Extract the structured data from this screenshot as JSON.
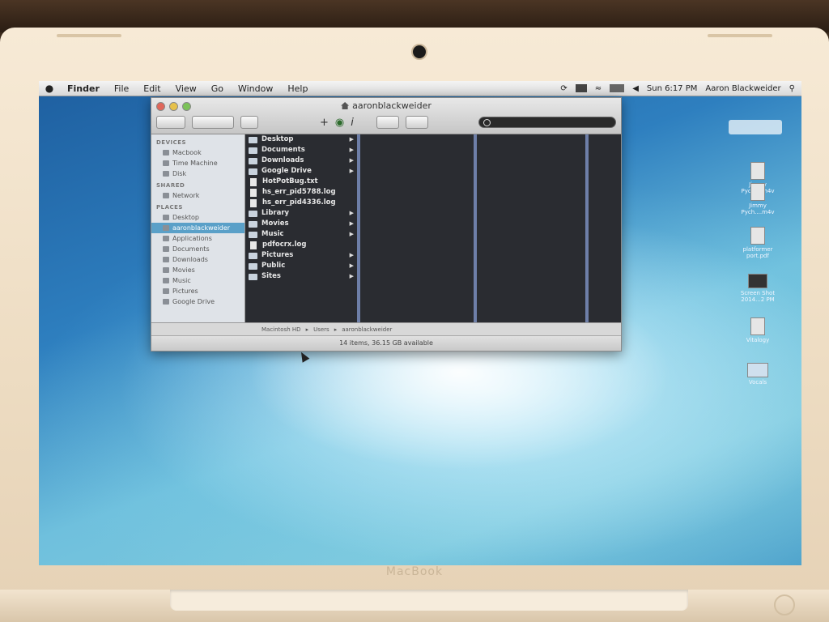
{
  "laptop": {
    "brand": "MacBook"
  },
  "menubar": {
    "items": [
      "Finder",
      "File",
      "Edit",
      "View",
      "Go",
      "Window",
      "Help"
    ],
    "clock": "Sun 6:17 PM",
    "user": "Aaron Blackweider"
  },
  "finder": {
    "title": "aaronblackweider",
    "search_placeholder": "",
    "sidebar": {
      "devices_header": "DEVICES",
      "devices": [
        "Macbook",
        "Time Machine",
        "Disk"
      ],
      "shared_header": "SHARED",
      "shared": [
        "Network"
      ],
      "places_header": "PLACES",
      "places": [
        "Desktop",
        "aaronblackweider",
        "Applications",
        "Documents",
        "Downloads",
        "Movies",
        "Music",
        "Pictures",
        "Google Drive"
      ]
    },
    "files": [
      {
        "name": "Desktop",
        "kind": "folder"
      },
      {
        "name": "Documents",
        "kind": "folder"
      },
      {
        "name": "Downloads",
        "kind": "folder"
      },
      {
        "name": "Google Drive",
        "kind": "folder"
      },
      {
        "name": "HotPotBug.txt",
        "kind": "file"
      },
      {
        "name": "hs_err_pid5788.log",
        "kind": "file"
      },
      {
        "name": "hs_err_pid4336.log",
        "kind": "file"
      },
      {
        "name": "Library",
        "kind": "folder"
      },
      {
        "name": "Movies",
        "kind": "folder"
      },
      {
        "name": "Music",
        "kind": "folder"
      },
      {
        "name": "pdfocrx.log",
        "kind": "file"
      },
      {
        "name": "Pictures",
        "kind": "folder"
      },
      {
        "name": "Public",
        "kind": "folder"
      },
      {
        "name": "Sites",
        "kind": "folder"
      }
    ],
    "path": [
      "Macintosh HD",
      "Users",
      "aaronblackweider"
    ],
    "status": "14 items, 36.15 GB available"
  },
  "desktop_icons": [
    {
      "label": "Jimmy Pych....m4v",
      "type": "file"
    },
    {
      "label": "Jimmy Pych....m4v",
      "type": "file"
    },
    {
      "label": "platformer port.pdf",
      "type": "file"
    },
    {
      "label": "Screen Shot 2014...2 PM",
      "type": "image"
    },
    {
      "label": "Vitalogy",
      "type": "file"
    },
    {
      "label": "Vocals",
      "type": "folder"
    }
  ]
}
